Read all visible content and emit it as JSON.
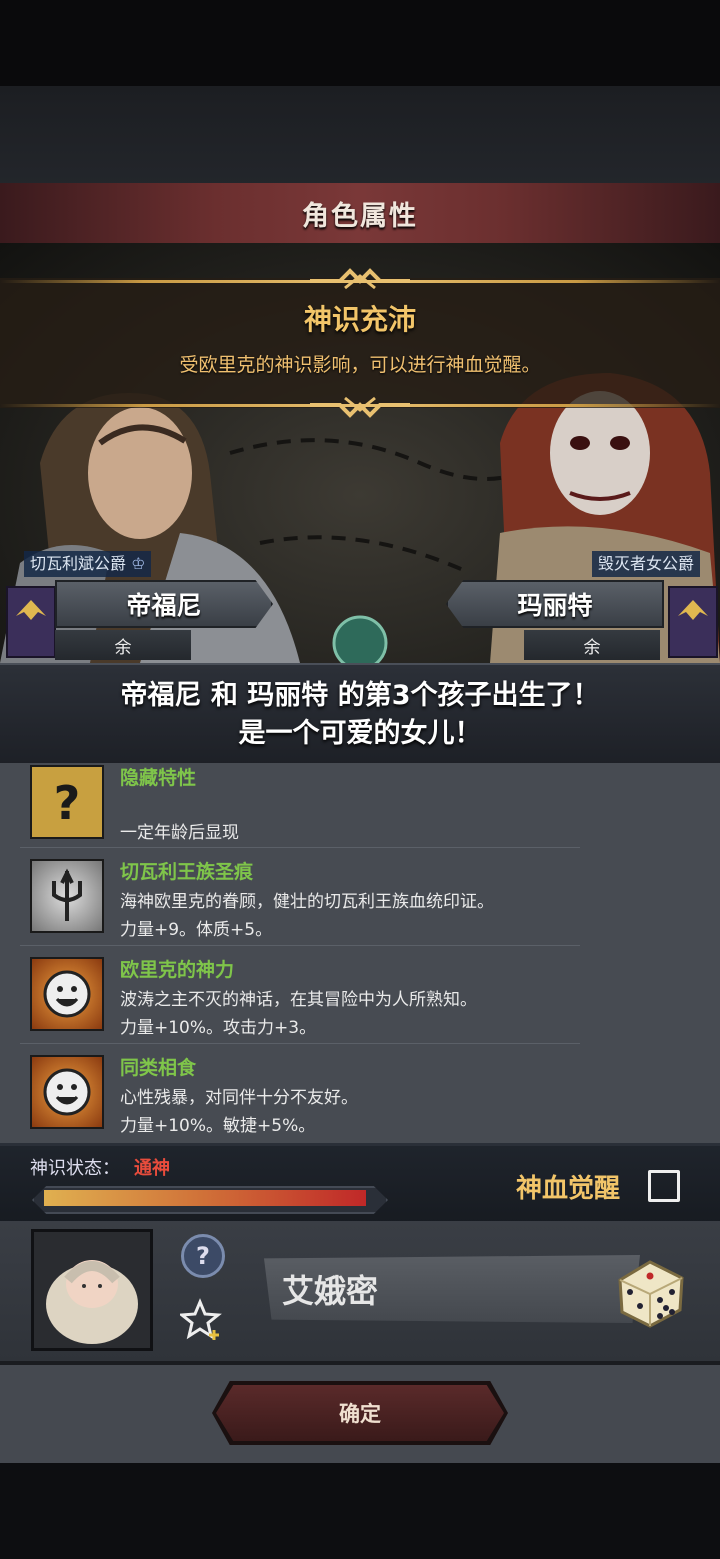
{
  "header": {
    "title": "角色属性"
  },
  "notice": {
    "title": "神识充沛",
    "description": "受欧里克的神识影响，可以进行神血觉醒。"
  },
  "parents": {
    "father": {
      "title": "切瓦利斌公爵",
      "name": "帝福尼",
      "sub": "余"
    },
    "mother": {
      "title": "毁灭者女公爵",
      "name": "玛丽特",
      "sub": "余"
    }
  },
  "announcement": {
    "line1": "帝福尼 和 玛丽特 的第3个孩子出生了！",
    "line2": "是一个可爱的女儿！"
  },
  "traits": [
    {
      "name": "隐藏特性",
      "lines": [
        "一定年龄后显现"
      ],
      "icon": "question-icon"
    },
    {
      "name": "切瓦利王族圣痕",
      "lines": [
        "海神欧里克的眷顾，健壮的切瓦利王族血统印证。",
        "力量+9。体质+5。"
      ],
      "icon": "trident-icon"
    },
    {
      "name": "欧里克的神力",
      "lines": [
        "波涛之主不灭的神话，在其冒险中为人所熟知。",
        "力量+10%。攻击力+3。"
      ],
      "icon": "smiley-icon"
    },
    {
      "name": "同类相食",
      "lines": [
        "心性残暴，对同伴十分不友好。",
        "力量+10%。敏捷+5%。"
      ],
      "icon": "smiley-icon"
    }
  ],
  "divine_state": {
    "label": "神识状态：",
    "value": "通神",
    "progress": 0.97,
    "awaken_label": "神血觉醒",
    "awaken_checked": false
  },
  "child": {
    "name": "艾娥密"
  },
  "footer": {
    "confirm_label": "确定"
  },
  "colors": {
    "accent_gold": "#f2c569",
    "trait_green": "#7fc54a",
    "state_red": "#e84c3c"
  }
}
